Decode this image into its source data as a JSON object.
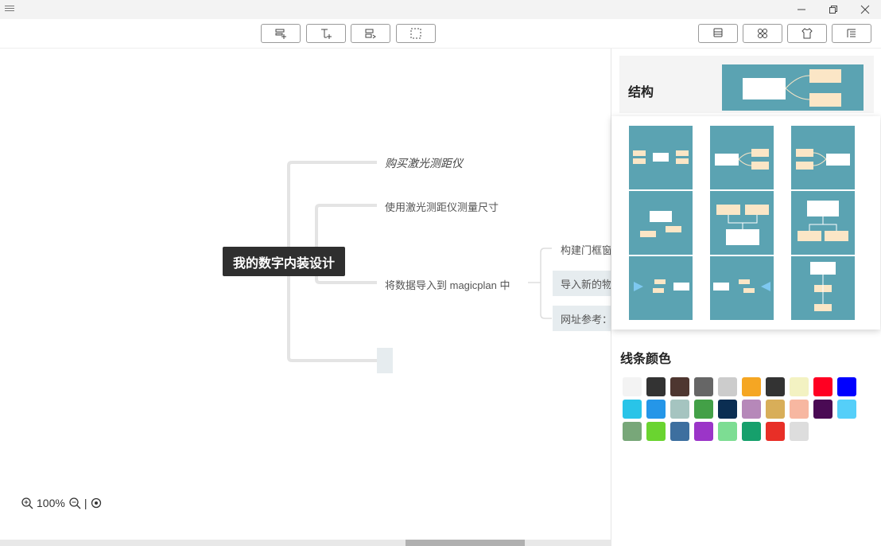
{
  "window": {
    "menu_icon": "hamburger-icon",
    "controls": [
      "minimize-icon",
      "restore-icon",
      "close-icon"
    ]
  },
  "toolbar": {
    "left_buttons": [
      "add-child-icon",
      "add-sibling-icon",
      "add-label-icon",
      "select-box-icon"
    ],
    "right_buttons": [
      "style-icon",
      "structure-icon",
      "theme-icon",
      "outline-icon"
    ]
  },
  "mindmap": {
    "root": "我的数字内装设计",
    "children": [
      "购买激光测距仪",
      "使用激光测距仪测量尺寸",
      "将数据导入到 magicplan 中"
    ],
    "grandchildren": [
      "构建门框窗",
      "导入新的物",
      "网址参考："
    ]
  },
  "zoom": {
    "level": "100%",
    "separator": "|"
  },
  "panel": {
    "structure_title": "结构",
    "line_color_title": "线条颜色",
    "line_colors": [
      "#f3f3f3",
      "#333333",
      "#4e3630",
      "#666666",
      "#cccccc",
      "#f5a623",
      "#333333",
      "#f3f2c2",
      "#ff0022",
      "#0000ff",
      "#29c4e8",
      "#2596e8",
      "#a5c4c0",
      "#43a047",
      "#0b2e52",
      "#b688b9",
      "#d8ae59",
      "#f7b7a1",
      "#4a0a54",
      "#55cff9",
      "#78a779",
      "#6ad430",
      "#3d6f9f",
      "#9b35c8",
      "#7ddd93",
      "#16a06c",
      "#e82f27",
      "#dddddd"
    ]
  },
  "colors": {
    "accent_teal": "#5ba3b2",
    "node_fill": "#fbe6c6"
  }
}
